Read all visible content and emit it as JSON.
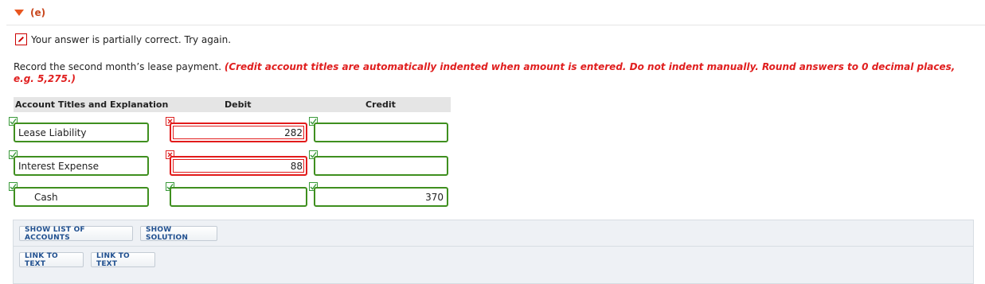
{
  "section": {
    "label": "(e)"
  },
  "status": {
    "text": "Your answer is partially correct.  Try again."
  },
  "instruction": {
    "plain": "Record the second month’s lease payment. ",
    "red": "(Credit account titles are automatically indented when amount is entered. Do not indent manually. Round answers to 0 decimal places, e.g. 5,275.)"
  },
  "table": {
    "headers": {
      "account": "Account Titles and Explanation",
      "debit": "Debit",
      "credit": "Credit"
    },
    "rows": [
      {
        "account": "Lease Liability",
        "debit": "282",
        "credit": "",
        "account_status": "correct",
        "debit_status": "incorrect",
        "credit_status": "correct"
      },
      {
        "account": "Interest Expense",
        "debit": "88",
        "credit": "",
        "account_status": "correct",
        "debit_status": "incorrect",
        "credit_status": "correct"
      },
      {
        "account": "Cash",
        "debit": "",
        "credit": "370",
        "account_status": "correct",
        "debit_status": "correct",
        "credit_status": "correct"
      }
    ]
  },
  "buttons": {
    "show_list": "SHOW LIST OF ACCOUNTS",
    "show_solution": "SHOW SOLUTION",
    "link_text_1": "LINK TO TEXT",
    "link_text_2": "LINK TO TEXT"
  },
  "colors": {
    "correct": "#3f8f1f",
    "incorrect": "#e21b1b",
    "accent": "#e8561f",
    "button_text": "#1f4f8f"
  }
}
